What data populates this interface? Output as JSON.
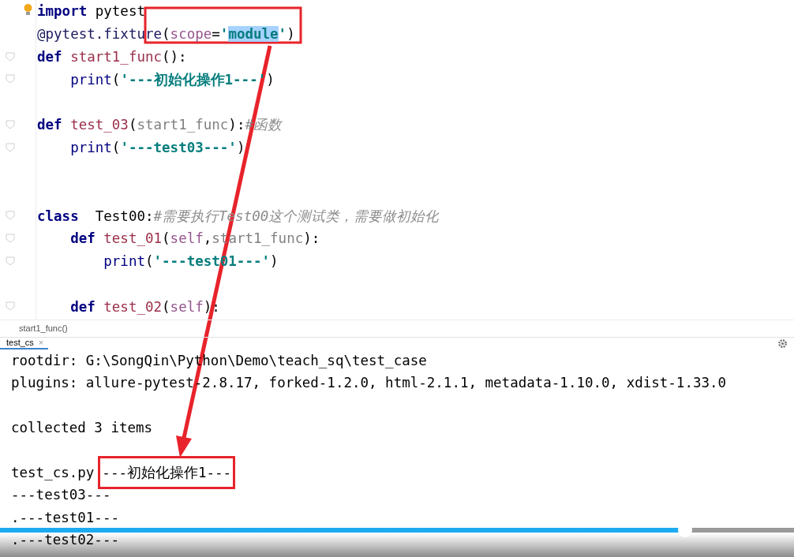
{
  "editor": {
    "lines": [
      {
        "fold_marker": false,
        "tokens": [
          {
            "kind": "keyword",
            "text": "import"
          },
          {
            "kind": "plain",
            "text": " pytest"
          }
        ]
      },
      {
        "fold_marker": false,
        "tokens": [
          {
            "kind": "decorator",
            "text": "@pytest.fixture"
          },
          {
            "kind": "plain",
            "text": "("
          },
          {
            "kind": "param",
            "text": "scope"
          },
          {
            "kind": "plain",
            "text": "="
          },
          {
            "kind": "string",
            "text": "'"
          },
          {
            "kind": "selected-string",
            "text": "module"
          },
          {
            "kind": "string",
            "text": "'"
          },
          {
            "kind": "plain",
            "text": ")"
          }
        ]
      },
      {
        "fold_marker": true,
        "tokens": [
          {
            "kind": "keyword",
            "text": "def"
          },
          {
            "kind": "function",
            "text": " start1_func"
          },
          {
            "kind": "plain",
            "text": "():"
          }
        ]
      },
      {
        "fold_marker": true,
        "tokens": [
          {
            "kind": "builtin",
            "text": "    print"
          },
          {
            "kind": "plain",
            "text": "("
          },
          {
            "kind": "string",
            "text": "'---初始化操作1---'"
          },
          {
            "kind": "plain",
            "text": ")"
          }
        ]
      },
      {
        "fold_marker": false
      },
      {
        "fold_marker": true,
        "tokens": [
          {
            "kind": "keyword",
            "text": "def"
          },
          {
            "kind": "function",
            "text": " test_03"
          },
          {
            "kind": "plain",
            "text": "("
          },
          {
            "kind": "unused",
            "text": "start1_func"
          },
          {
            "kind": "plain",
            "text": "):"
          },
          {
            "kind": "comment",
            "text": "#函数"
          }
        ]
      },
      {
        "fold_marker": true,
        "tokens": [
          {
            "kind": "builtin",
            "text": "    print"
          },
          {
            "kind": "plain",
            "text": "("
          },
          {
            "kind": "string",
            "text": "'---test03---'"
          },
          {
            "kind": "plain",
            "text": ")"
          }
        ]
      },
      {
        "fold_marker": false
      },
      {
        "fold_marker": false
      },
      {
        "fold_marker": true,
        "tokens": [
          {
            "kind": "keyword",
            "text": "class"
          },
          {
            "kind": "plain",
            "text": "  Test00:"
          },
          {
            "kind": "comment",
            "text": "#需要执行Test00这个测试类，需要做初始化"
          }
        ]
      },
      {
        "fold_marker": true,
        "tokens": [
          {
            "kind": "keyword",
            "text": "    def"
          },
          {
            "kind": "function",
            "text": " test_01"
          },
          {
            "kind": "plain",
            "text": "("
          },
          {
            "kind": "param",
            "text": "self"
          },
          {
            "kind": "plain",
            "text": ","
          },
          {
            "kind": "unused",
            "text": "start1_func"
          },
          {
            "kind": "plain",
            "text": "):"
          }
        ]
      },
      {
        "fold_marker": true,
        "tokens": [
          {
            "kind": "builtin",
            "text": "        print"
          },
          {
            "kind": "plain",
            "text": "("
          },
          {
            "kind": "string",
            "text": "'---test01---'"
          },
          {
            "kind": "plain",
            "text": ")"
          }
        ]
      },
      {
        "fold_marker": false
      },
      {
        "fold_marker": true,
        "tokens": [
          {
            "kind": "keyword",
            "text": "    def"
          },
          {
            "kind": "function",
            "text": " test_02"
          },
          {
            "kind": "plain",
            "text": "("
          },
          {
            "kind": "param",
            "text": "self"
          },
          {
            "kind": "plain",
            "text": "):"
          }
        ]
      }
    ]
  },
  "breadcrumb": "start1_func()",
  "run_tab": {
    "label": "test_cs",
    "close": "×"
  },
  "console": {
    "lines": [
      {
        "blank": false,
        "text": "rootdir: G:\\SongQin\\Python\\Demo\\teach_sq\\test_case"
      },
      {
        "blank": false,
        "text": "plugins: allure-pytest-2.8.17, forked-1.2.0, html-2.1.1, metadata-1.10.0, xdist-1.33.0"
      },
      {
        "blank": true
      },
      {
        "blank": false,
        "text": "collected 3 items"
      },
      {
        "blank": true
      },
      {
        "blank": false,
        "text": "test_cs.py",
        "highlighted": "---初始化操作1---"
      },
      {
        "blank": false,
        "text": "---test03---"
      },
      {
        "blank": false,
        "text": ".---test01---"
      },
      {
        "blank": false,
        "text": ".---test02---"
      }
    ]
  },
  "video_progress": {
    "level": 0.863
  }
}
